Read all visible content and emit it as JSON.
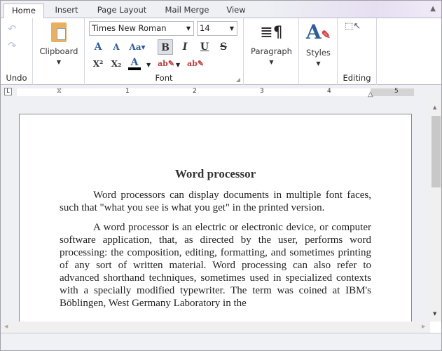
{
  "tabs": [
    "Home",
    "Insert",
    "Page Layout",
    "Mail Merge",
    "View"
  ],
  "ribbon": {
    "undo_group": "Undo",
    "clipboard": "Clipboard",
    "font_group": "Font",
    "font_name": "Times New Roman",
    "font_size": "14",
    "paragraph": "Paragraph",
    "styles": "Styles",
    "editing": "Editing"
  },
  "ruler": [
    "1",
    "2",
    "3",
    "4",
    "5"
  ],
  "document": {
    "title": "Word processor",
    "paragraphs": [
      "Word processors can display documents in multiple font faces, such that \"what you see is what you get\" in the printed version.",
      "A word processor is an electric or electronic device, or computer software application, that, as directed by the user, performs word processing: the composition, editing, formatting, and sometimes printing of any sort of written material. Word processing can also refer to advanced shorthand techniques, sometimes used in specialized contexts with a specially modified typewriter. The term was coined at IBM's Böblingen, West Germany Laboratory in the"
    ]
  },
  "colors": {
    "accent": "#2f5d9a",
    "ribbon_border": "#b8bcc8"
  }
}
